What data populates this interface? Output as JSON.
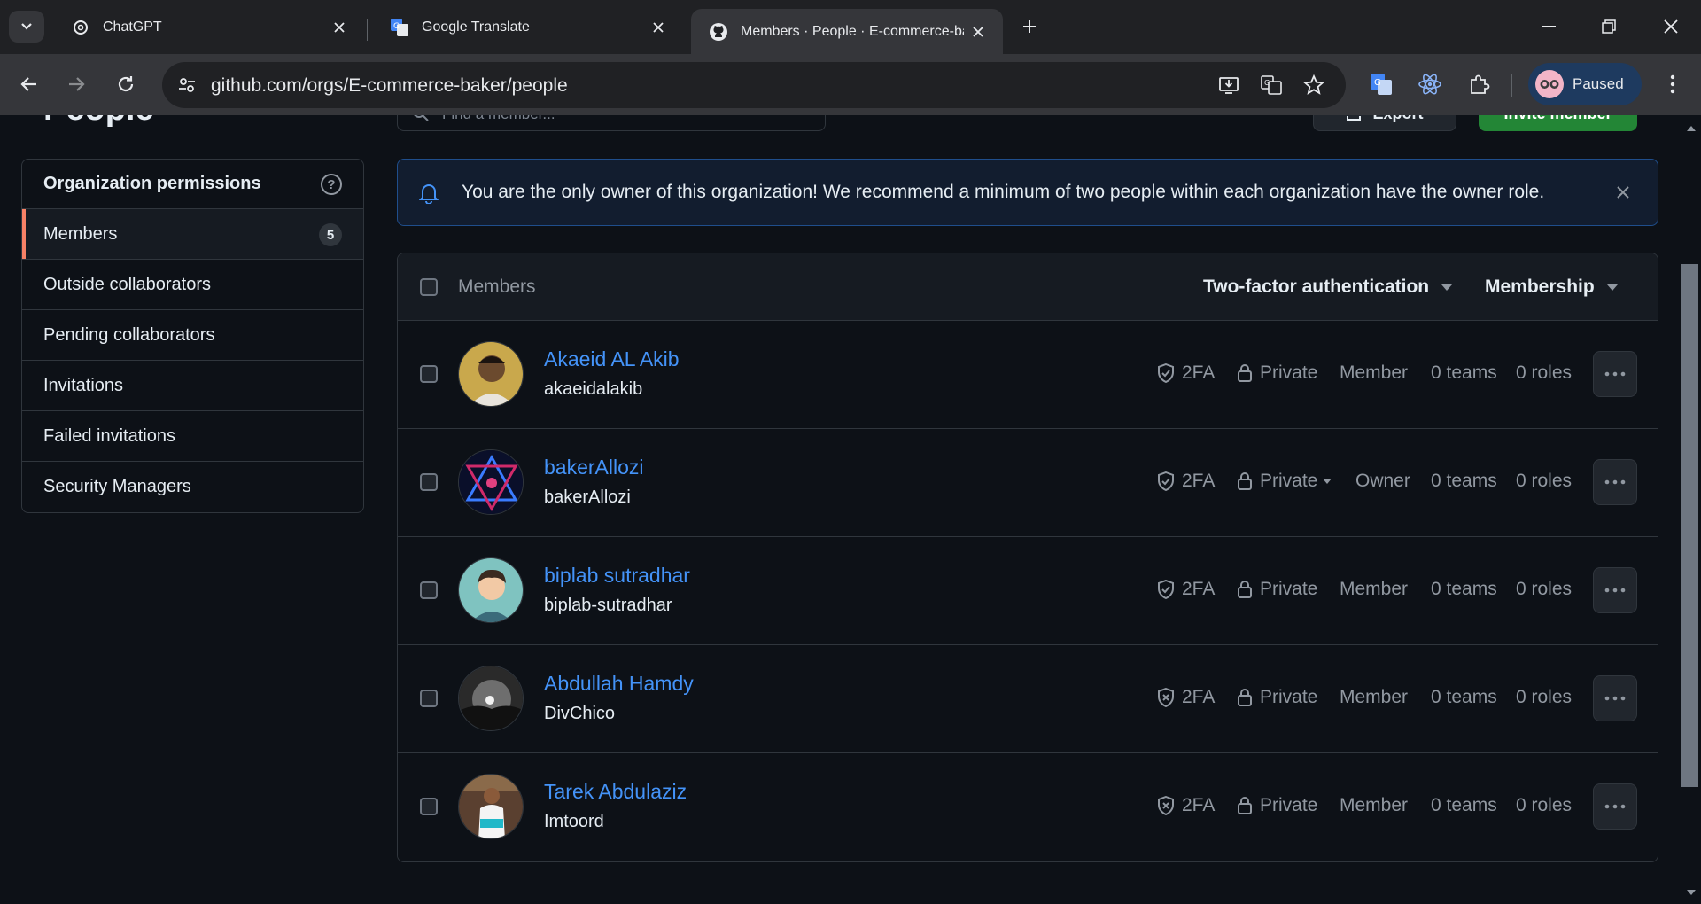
{
  "browser": {
    "tabs": [
      {
        "title": "ChatGPT"
      },
      {
        "title": "Google Translate"
      },
      {
        "title": "Members · People · E-commerce-baker"
      }
    ],
    "url": "github.com/orgs/E-commerce-baker/people",
    "profile_status": "Paused"
  },
  "page": {
    "title": "People",
    "search_placeholder": "Find a member...",
    "export_label": "Export",
    "invite_label": "Invite member"
  },
  "sidebar": {
    "header": "Organization permissions",
    "help": "?",
    "items": [
      {
        "label": "Members",
        "count": "5"
      },
      {
        "label": "Outside collaborators"
      },
      {
        "label": "Pending collaborators"
      },
      {
        "label": "Invitations"
      },
      {
        "label": "Failed invitations"
      },
      {
        "label": "Security Managers"
      }
    ]
  },
  "alert": {
    "message": "You are the only owner of this organization! We recommend a minimum of two people within each organization have the owner role."
  },
  "table": {
    "header": "Members",
    "filters": [
      "Two-factor authentication",
      "Membership"
    ],
    "members": [
      {
        "name": "Akaeid AL Akib",
        "login": "akaeidalakib",
        "tfa": "2FA",
        "tfa_enabled": true,
        "visibility": "Private",
        "role": "Member",
        "teams": "0 teams",
        "roles": "0 roles"
      },
      {
        "name": "bakerAllozi",
        "login": "bakerAllozi",
        "tfa": "2FA",
        "tfa_enabled": true,
        "visibility": "Private",
        "role": "Owner",
        "teams": "0 teams",
        "roles": "0 roles"
      },
      {
        "name": "biplab sutradhar",
        "login": "biplab-sutradhar",
        "tfa": "2FA",
        "tfa_enabled": true,
        "visibility": "Private",
        "role": "Member",
        "teams": "0 teams",
        "roles": "0 roles"
      },
      {
        "name": "Abdullah Hamdy",
        "login": "DivChico",
        "tfa": "2FA",
        "tfa_enabled": false,
        "visibility": "Private",
        "role": "Member",
        "teams": "0 teams",
        "roles": "0 roles"
      },
      {
        "name": "Tarek Abdulaziz",
        "login": "Imtoord",
        "tfa": "2FA",
        "tfa_enabled": false,
        "visibility": "Private",
        "role": "Member",
        "teams": "0 teams",
        "roles": "0 roles"
      }
    ]
  },
  "colors": {
    "accent_link": "#4493f8",
    "active_marker": "#f78166",
    "invite_green": "#238636"
  }
}
